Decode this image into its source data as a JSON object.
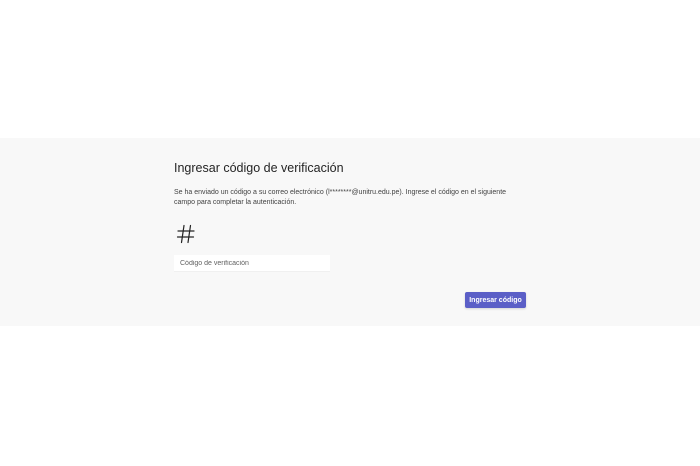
{
  "verification": {
    "title": "Ingresar código de verificación",
    "description": "Se ha enviado un código a su correo electrónico (l********@unitru.edu.pe). Ingrese el código en el siguiente campo para completar la autenticación.",
    "icon": "hash-icon",
    "code_input": {
      "value": "",
      "placeholder": "Código de verificación"
    },
    "submit_label": "Ingresar código"
  },
  "colors": {
    "page_background": "#ffffff",
    "band_background": "#f8f8f8",
    "accent": "#5b5fc7",
    "title_text": "#242424",
    "body_text": "#424242"
  }
}
